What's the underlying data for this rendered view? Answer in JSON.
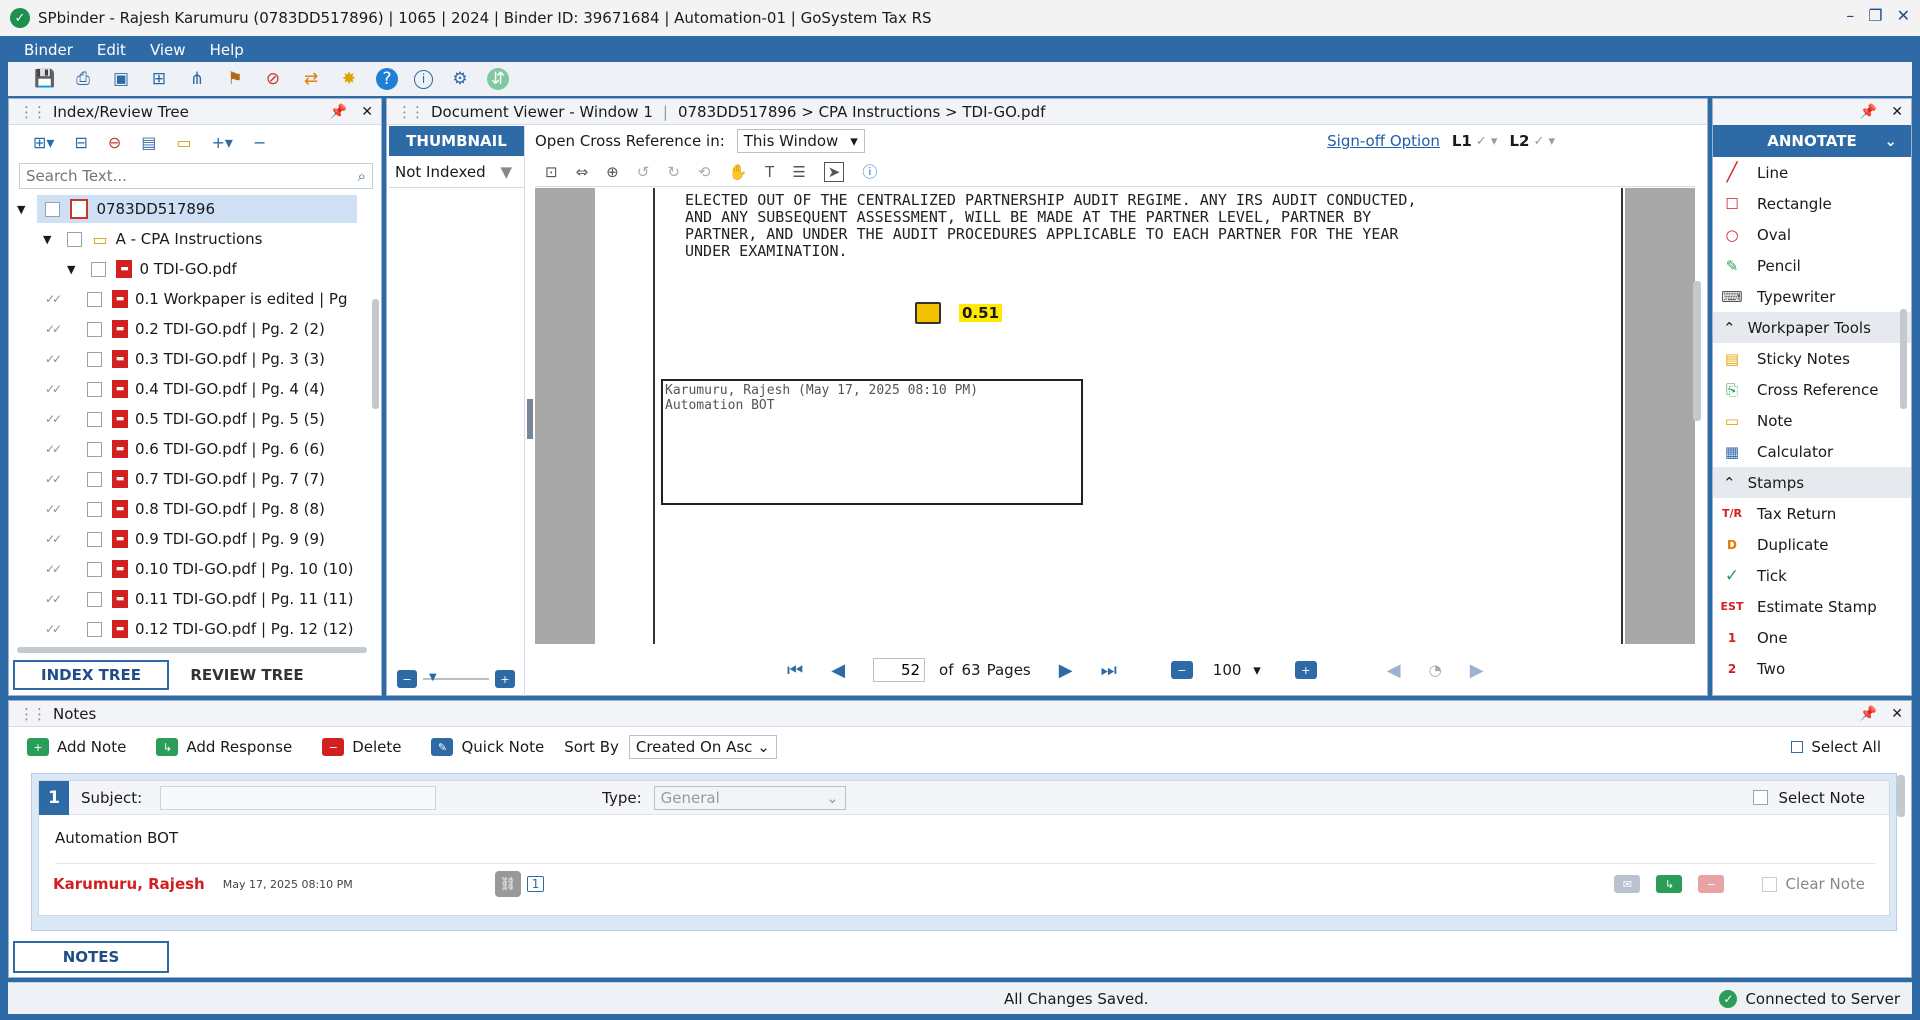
{
  "window": {
    "title": "SPbinder - Rajesh Karumuru (0783DD517896) | 1065 | 2024 | Binder ID: 39671684 | Automation-01 | GoSystem Tax RS",
    "controls": [
      "–",
      "❐",
      "✕"
    ]
  },
  "menu": [
    "Binder",
    "Edit",
    "View",
    "Help"
  ],
  "index_tree": {
    "title": "Index/Review Tree",
    "search_placeholder": "Search Text...",
    "root": "0783DD517896",
    "folder": "A - CPA Instructions",
    "file": "0 TDI-GO.pdf",
    "items": [
      "0.1 Workpaper is edited  | Pg",
      "0.2 TDI-GO.pdf  | Pg. 2 (2)",
      "0.3 TDI-GO.pdf  | Pg. 3 (3)",
      "0.4 TDI-GO.pdf  | Pg. 4 (4)",
      "0.5 TDI-GO.pdf  | Pg. 5 (5)",
      "0.6 TDI-GO.pdf  | Pg. 6 (6)",
      "0.7 TDI-GO.pdf  | Pg. 7 (7)",
      "0.8 TDI-GO.pdf  | Pg. 8 (8)",
      "0.9 TDI-GO.pdf  | Pg. 9 (9)",
      "0.10 TDI-GO.pdf  | Pg. 10 (10)",
      "0.11 TDI-GO.pdf  | Pg. 11 (11)",
      "0.12 TDI-GO.pdf  | Pg. 12 (12)"
    ],
    "tab_index": "INDEX TREE",
    "tab_review": "REVIEW TREE"
  },
  "viewer": {
    "title": "Document Viewer - Window 1",
    "path": "0783DD517896 > CPA Instructions > TDI-GO.pdf",
    "thumbnail_tab": "THUMBNAIL",
    "filter": "Not Indexed",
    "open_xref_label": "Open Cross Reference in:",
    "open_xref_value": "This Window",
    "signoff": "Sign-off Option",
    "l1": "L1",
    "l2": "L2",
    "doc_lines": [
      "ELECTED OUT OF THE CENTRALIZED PARTNERSHIP AUDIT REGIME. ANY IRS AUDIT CONDUCTED,",
      "AND ANY SUBSEQUENT ASSESSMENT, WILL BE MADE AT THE PARTNER LEVEL, PARTNER BY",
      "PARTNER, AND UNDER THE AUDIT PROCEDURES APPLICABLE TO EACH PARTNER FOR THE YEAR",
      "UNDER EXAMINATION."
    ],
    "note_badge": "0.51",
    "stamp_line1": "Karumuru, Rajesh (May 17, 2025 08:10 PM)",
    "stamp_line2": "Automation BOT",
    "page": "52",
    "of": "of",
    "total": "63",
    "pages_label": "Pages",
    "zoom": "100"
  },
  "annotate": {
    "title": "ANNOTATE",
    "tools": [
      {
        "label": "Line",
        "icon": "line-icon"
      },
      {
        "label": "Rectangle",
        "icon": "rectangle-icon"
      },
      {
        "label": "Oval",
        "icon": "oval-icon"
      },
      {
        "label": "Pencil",
        "icon": "pencil-icon"
      },
      {
        "label": "Typewriter",
        "icon": "typewriter-icon"
      }
    ],
    "section_workpaper": "Workpaper Tools",
    "wp_tools": [
      {
        "label": "Sticky Notes",
        "icon": "sticky-notes-icon"
      },
      {
        "label": "Cross Reference",
        "icon": "cross-reference-icon"
      },
      {
        "label": "Note",
        "icon": "note-icon"
      },
      {
        "label": "Calculator",
        "icon": "calculator-icon"
      }
    ],
    "section_stamps": "Stamps",
    "stamps": [
      {
        "label": "Tax Return",
        "glyph": "T/R"
      },
      {
        "label": "Duplicate",
        "glyph": "D"
      },
      {
        "label": "Tick",
        "glyph": "✓"
      },
      {
        "label": "Estimate Stamp",
        "glyph": "EST"
      },
      {
        "label": "One",
        "glyph": "1"
      },
      {
        "label": "Two",
        "glyph": "2"
      }
    ]
  },
  "notes": {
    "title": "Notes",
    "add_note": "Add Note",
    "add_response": "Add Response",
    "delete": "Delete",
    "quick_note": "Quick Note",
    "sort_by": "Sort By",
    "sort_value": "Created On Asc",
    "select_all": "Select All",
    "card": {
      "number": "1",
      "subject_label": "Subject:",
      "type_label": "Type:",
      "type_value": "General",
      "select_note": "Select Note",
      "body": "Automation BOT",
      "author": "Karumuru, Rajesh",
      "date": "May 17, 2025 08:10 PM",
      "link_count": "1",
      "clear_note": "Clear Note"
    },
    "tab": "NOTES"
  },
  "status": {
    "center": "All Changes Saved.",
    "right": "Connected to Server"
  },
  "colors": {
    "brand": "#2e6aa5",
    "accent_red": "#d21f1f",
    "highlight": "#ffea00"
  }
}
